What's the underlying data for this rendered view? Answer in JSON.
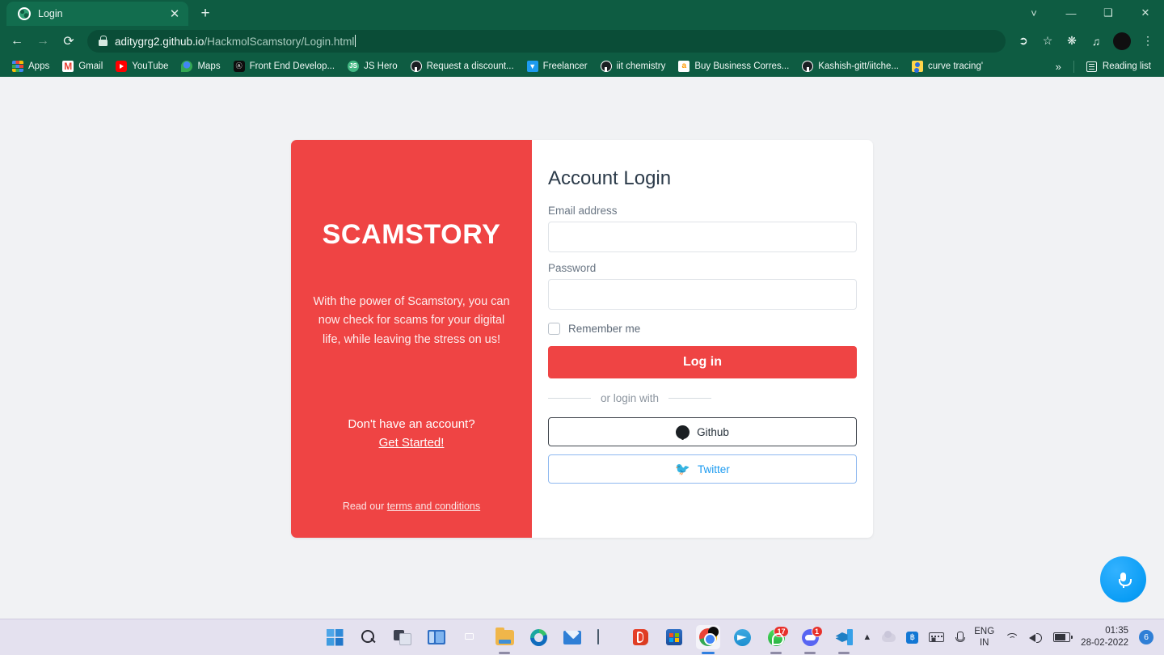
{
  "browser": {
    "tab": {
      "title": "Login",
      "favicon_icon": "globe-favicon",
      "close_icon": "close-icon"
    },
    "newtab_icon": "plus-icon",
    "window_controls": {
      "tab_search_icon": "chevron-down-icon",
      "minimize_icon": "minimize-icon",
      "maximize_icon": "maximize-icon",
      "close_icon": "close-icon"
    },
    "nav": {
      "back_icon": "arrow-left-icon",
      "forward_icon": "arrow-right-icon",
      "reload_icon": "reload-icon"
    },
    "omnibox": {
      "lock_icon": "lock-icon",
      "url_domain": "aditygrg2.github.io",
      "url_path": "/HackmolScamstory/Login.html",
      "full_url": "aditygrg2.github.io/HackmolScamstory/Login.html"
    },
    "toolbar_icons": [
      {
        "name": "share-icon",
        "glyph": "➦"
      },
      {
        "name": "bookmark-star-icon",
        "glyph": "☆"
      },
      {
        "name": "extensions-puzzle-icon",
        "glyph": "🧩"
      },
      {
        "name": "media-control-icon",
        "glyph": "♫"
      }
    ],
    "avatar_name": "profile-avatar",
    "menu_icon": "three-dot-menu-icon",
    "bookmarks": [
      {
        "label": "Apps",
        "favicon": "apps-grid-icon"
      },
      {
        "label": "Gmail",
        "favicon": "gmail-icon"
      },
      {
        "label": "YouTube",
        "favicon": "youtube-icon"
      },
      {
        "label": "Maps",
        "favicon": "google-maps-icon"
      },
      {
        "label": "Front End Develop...",
        "favicon": "dark-a-icon"
      },
      {
        "label": "JS Hero",
        "favicon": "js-icon"
      },
      {
        "label": "Request a discount...",
        "favicon": "github-icon"
      },
      {
        "label": "Freelancer",
        "favicon": "freelancer-icon"
      },
      {
        "label": "iit chemistry",
        "favicon": "github-icon"
      },
      {
        "label": "Buy Business Corres...",
        "favicon": "amazon-icon"
      },
      {
        "label": "Kashish-gitt/iitche...",
        "favicon": "github-icon"
      },
      {
        "label": "curve tracing'",
        "favicon": "person-icon"
      }
    ],
    "bookmarks_overflow_label": "»",
    "reading_list_label": "Reading list",
    "reading_list_icon": "reading-list-icon"
  },
  "page": {
    "background_color": "#f1f2f4",
    "brand_color": "#ef4444",
    "left_panel": {
      "brand": "SCAMSTORY",
      "tagline": "With the power of Scamstory, you can now check for scams for your digital life, while leaving the stress on us!",
      "no_account_text": "Don't have an account?",
      "get_started_link": "Get Started!",
      "terms_prefix": "Read our ",
      "terms_link": "terms and conditions"
    },
    "form": {
      "title": "Account Login",
      "email_label": "Email address",
      "email_value": "",
      "email_placeholder": "",
      "password_label": "Password",
      "password_value": "",
      "password_placeholder": "",
      "remember_label": "Remember me",
      "remember_checked": false,
      "login_button": "Log in",
      "divider_text": "or login with",
      "oauth": [
        {
          "label": "Github",
          "icon": "github-icon"
        },
        {
          "label": "Twitter",
          "icon": "twitter-icon"
        }
      ]
    },
    "fab": {
      "name": "voice-mic-fab",
      "icon": "microphone-icon",
      "color": "#0a9df5"
    }
  },
  "taskbar": {
    "background_color": "#e4e1ef",
    "items": [
      {
        "name": "start-button",
        "icon": "windows-logo-icon",
        "running": false
      },
      {
        "name": "search-button",
        "icon": "search-icon",
        "running": false
      },
      {
        "name": "task-view-button",
        "icon": "task-view-icon",
        "running": false
      },
      {
        "name": "widgets-button",
        "icon": "widgets-icon",
        "running": false
      },
      {
        "name": "chat-button",
        "icon": "chat-icon",
        "running": false
      },
      {
        "name": "file-explorer-button",
        "icon": "folder-icon",
        "running": true
      },
      {
        "name": "edge-button",
        "icon": "edge-icon",
        "running": false
      },
      {
        "name": "mail-button",
        "icon": "mail-icon",
        "running": false
      },
      {
        "name": "remote-desktop-button",
        "icon": "monitor-icon",
        "running": false
      },
      {
        "name": "office-button",
        "icon": "office-icon",
        "running": false
      },
      {
        "name": "microsoft-store-button",
        "icon": "store-icon",
        "running": false
      },
      {
        "name": "chrome-button",
        "icon": "chrome-icon",
        "running": true,
        "active": true
      },
      {
        "name": "telegram-button",
        "icon": "telegram-icon",
        "running": false
      },
      {
        "name": "whatsapp-button",
        "icon": "whatsapp-icon",
        "running": true,
        "badge": "17"
      },
      {
        "name": "discord-button",
        "icon": "discord-icon",
        "running": true,
        "badge": "1"
      },
      {
        "name": "vscode-button",
        "icon": "vscode-icon",
        "running": true
      }
    ],
    "tray": {
      "overflow_icon": "chevron-up-icon",
      "onedrive_icon": "cloud-icon",
      "bluetooth_icon": "bluetooth-icon",
      "bluetooth_glyph": "฿",
      "keyboard_icon": "keyboard-icon",
      "mic_icon": "microphone-icon",
      "language_primary": "ENG",
      "language_secondary": "IN",
      "wifi_icon": "wifi-icon",
      "volume_icon": "volume-icon",
      "battery_icon": "battery-icon",
      "time": "01:35",
      "date": "28-02-2022",
      "notification_count": "6"
    }
  }
}
